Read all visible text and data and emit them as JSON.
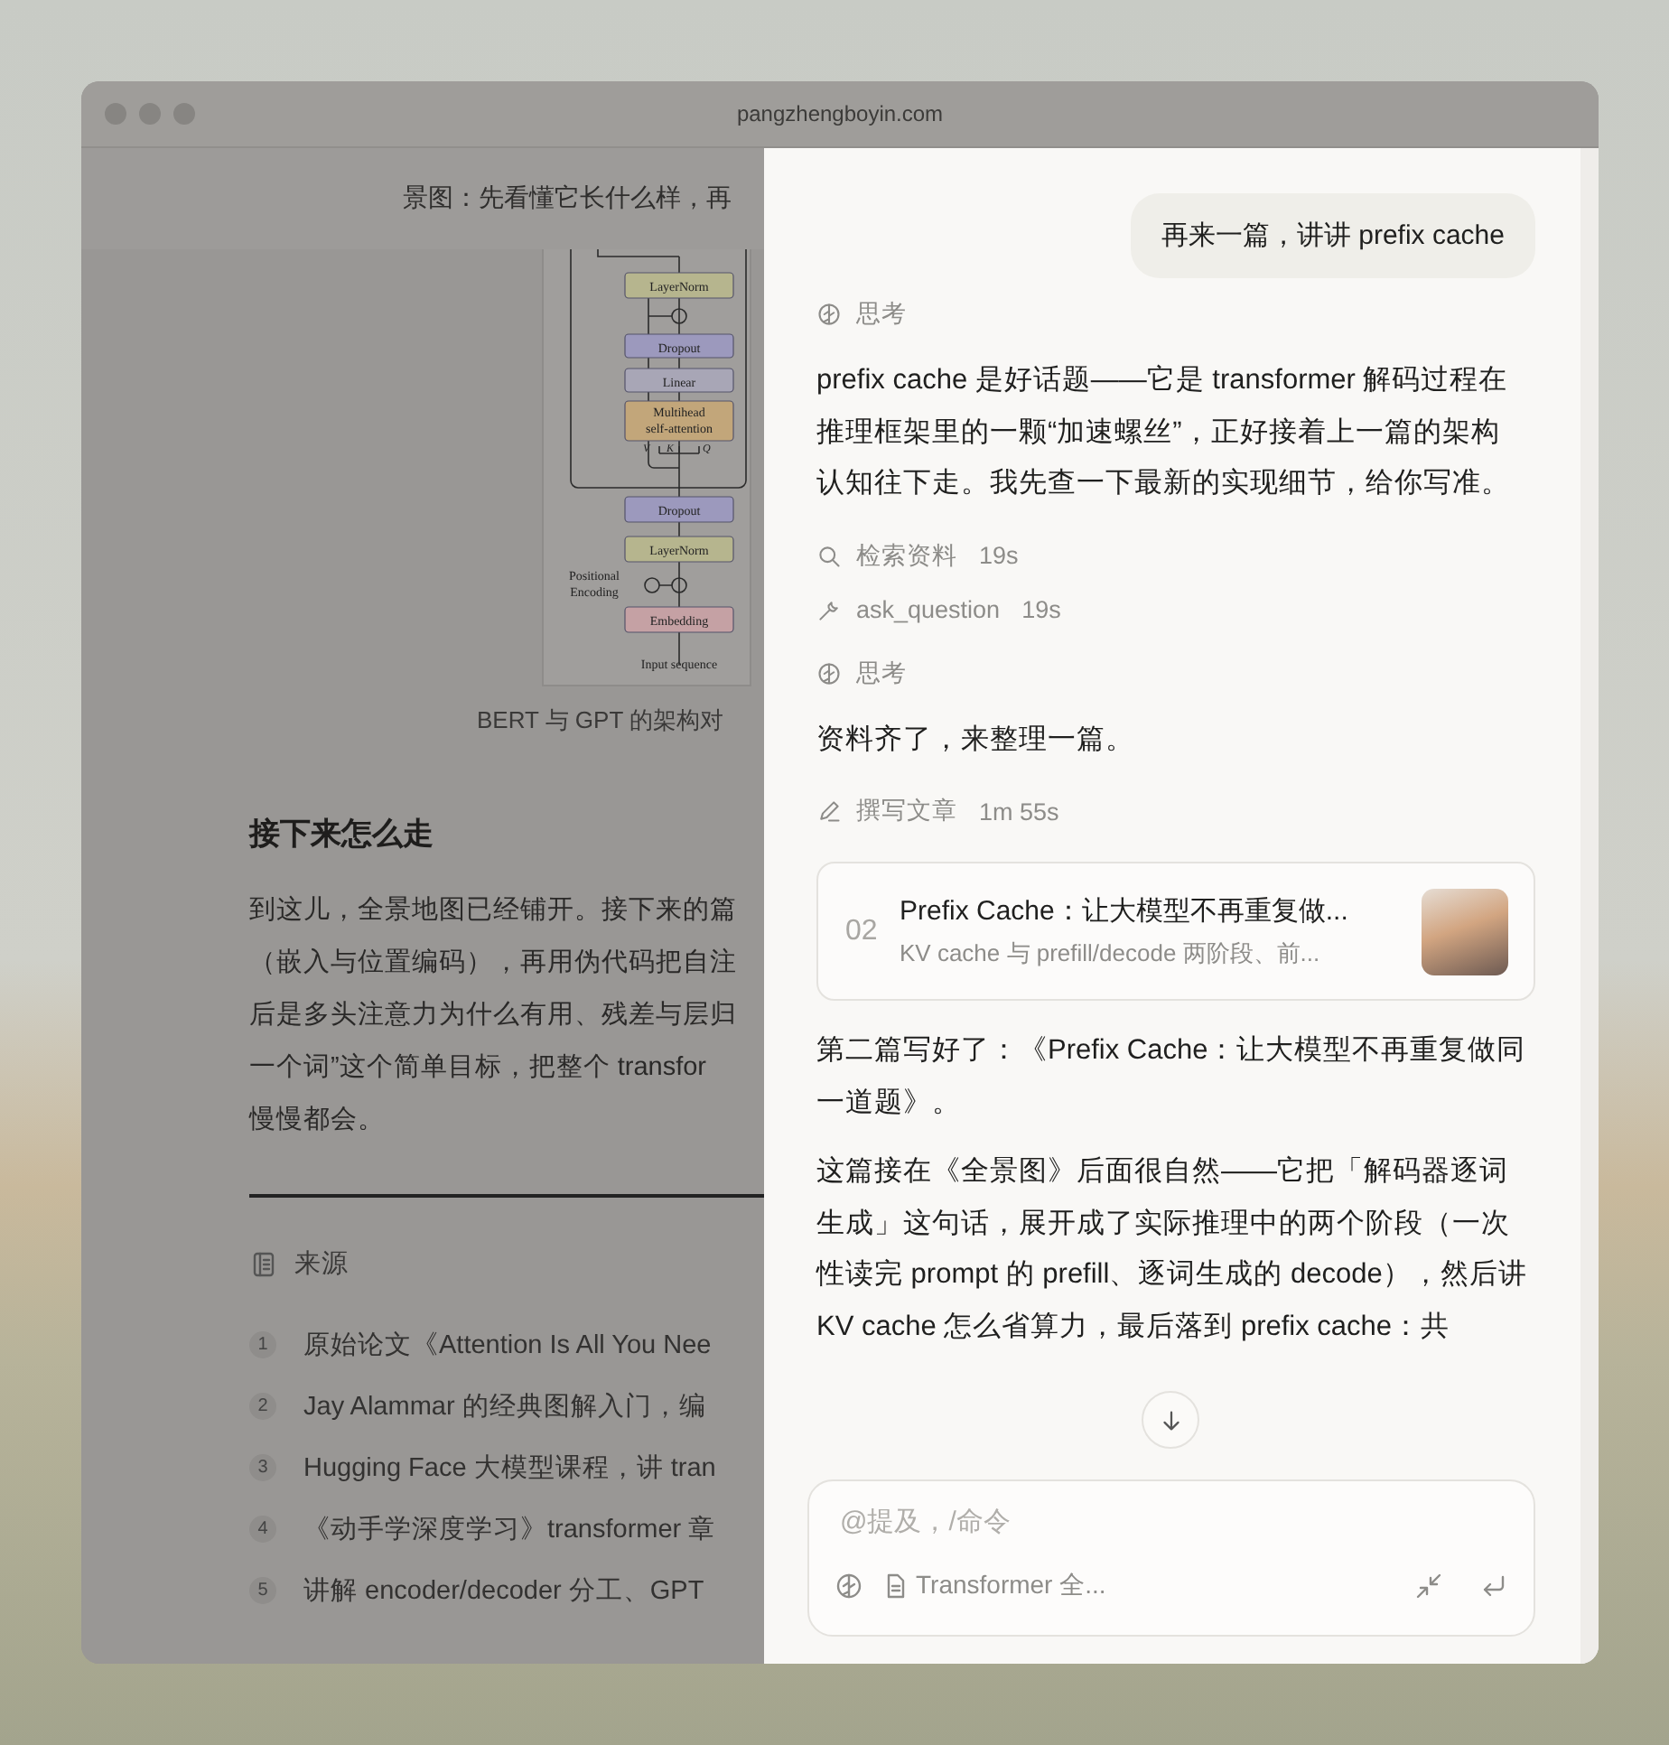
{
  "window": {
    "url": "pangzhengboyin.com"
  },
  "article": {
    "header_text": "景图：先看懂它长什么样，再",
    "figure": {
      "blocks": [
        {
          "lines": [
            "LayerNorm"
          ],
          "color": "#b6b58e"
        },
        {
          "lines": [
            "Dropout"
          ],
          "color": "#9c99bd"
        },
        {
          "lines": [
            "Linear"
          ],
          "color": "#a8a6b6"
        },
        {
          "lines": [
            "Multihead",
            "self-attention"
          ],
          "color": "#c2a67a"
        },
        {
          "lines": [
            "Dropout"
          ],
          "color": "#9c99bd"
        },
        {
          "lines": [
            "LayerNorm"
          ],
          "color": "#b6b58e"
        },
        {
          "lines": [
            "Embedding"
          ],
          "color": "#c5a1a4"
        }
      ],
      "inputs": [
        "V",
        "K",
        "Q"
      ],
      "side_label": [
        "Positional",
        "Encoding"
      ],
      "bottom_label": "Input sequence"
    },
    "caption": "BERT 与 GPT 的架构对",
    "heading": "接下来怎么走",
    "paragraph_lines": [
      "到这儿，全景地图已经铺开。接下来的篇",
      "（嵌入与位置编码），再用伪代码把自注",
      "后是多头注意力为什么有用、残差与层归",
      "一个词”这个简单目标，把整个 transfor",
      "慢慢都会。"
    ],
    "sources": {
      "title": "来源",
      "items": [
        {
          "number": "1",
          "text": "原始论文《Attention Is All You Nee"
        },
        {
          "number": "2",
          "text": "Jay Alammar 的经典图解入门，编"
        },
        {
          "number": "3",
          "text": "Hugging Face 大模型课程，讲 tran"
        },
        {
          "number": "4",
          "text": "《动手学深度学习》transformer 章"
        },
        {
          "number": "5",
          "text": "讲解 encoder/decoder 分工、GPT"
        }
      ]
    }
  },
  "chat": {
    "messages": [
      {
        "kind": "user",
        "text": "再来一篇，讲讲 prefix cache"
      },
      {
        "kind": "think",
        "label": "思考"
      },
      {
        "kind": "text",
        "text": "prefix cache 是好话题——它是 transformer 解码过程在推理框架里的一颗“加速螺丝”，正好接着上一篇的架构认知往下走。我先查一下最新的实现细节，给你写准。"
      },
      {
        "kind": "search",
        "label": "检索资料",
        "time": "19s"
      },
      {
        "kind": "tool",
        "label": "ask_question",
        "time": "19s"
      },
      {
        "kind": "think",
        "label": "思考"
      },
      {
        "kind": "text",
        "text": "资料齐了，来整理一篇。"
      },
      {
        "kind": "write",
        "label": "撰写文章",
        "time": "1m 55s"
      },
      {
        "kind": "card",
        "number": "02",
        "title": "Prefix Cache：让大模型不再重复做...",
        "subtitle": "KV cache 与 prefill/decode 两阶段、前..."
      },
      {
        "kind": "text",
        "text": "第二篇写好了：《Prefix Cache：让大模型不再重复做同一道题》。"
      },
      {
        "kind": "text",
        "text": "这篇接在《全景图》后面很自然——它把「解码器逐词生成」这句话，展开成了实际推理中的两个阶段（一次性读完 prompt 的 prefill、逐词生成的 decode），然后讲 KV cache 怎么省算力，最后落到 prefix cache：共"
      }
    ],
    "input": {
      "placeholder": "@提及，/命令",
      "attachment": "Transformer 全..."
    }
  }
}
